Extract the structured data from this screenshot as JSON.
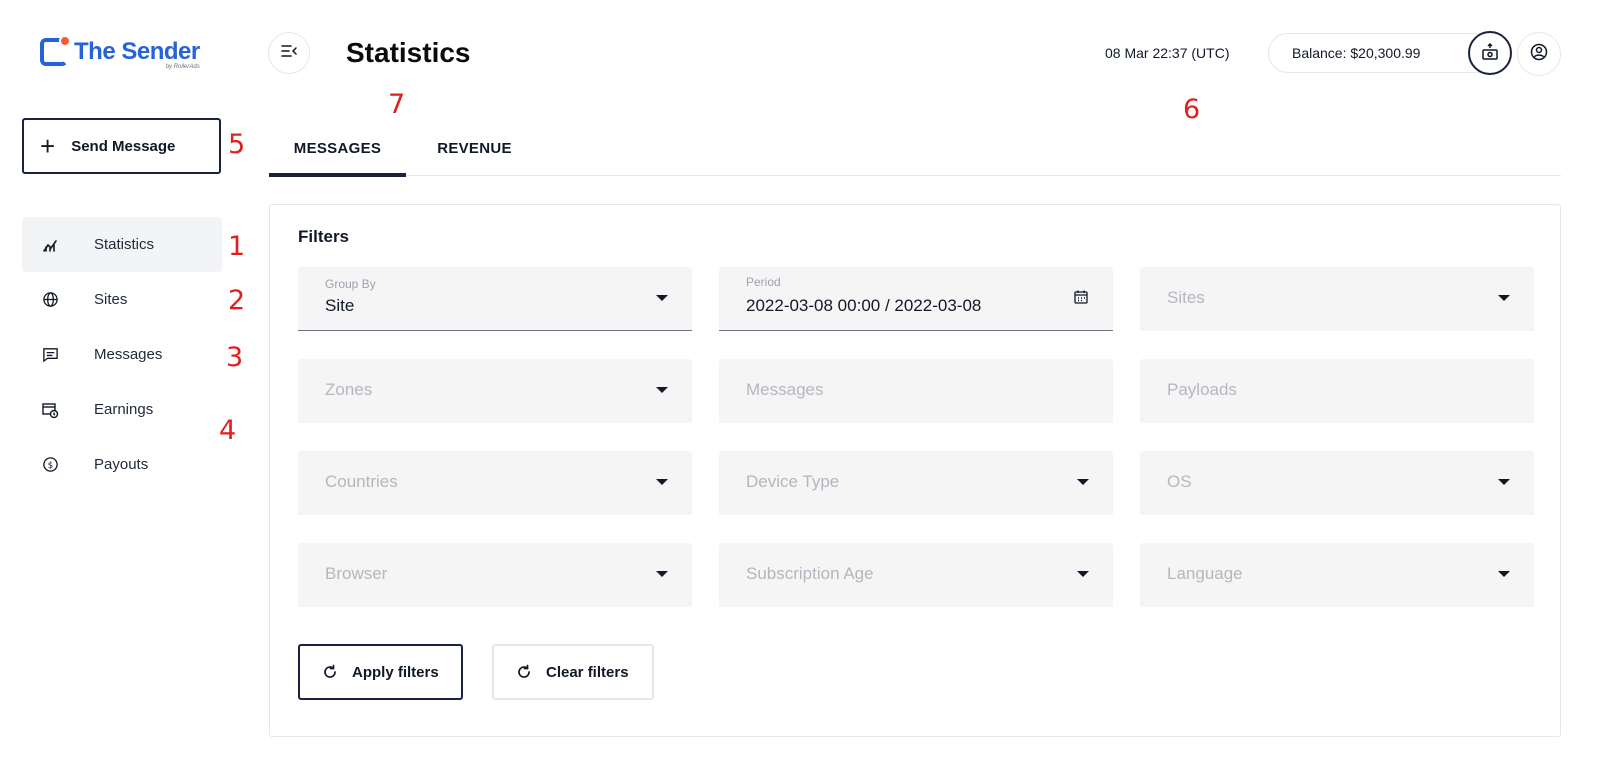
{
  "brand": {
    "name": "The Sender",
    "sub": "by RollerAds"
  },
  "send_button": {
    "label": "Send Message"
  },
  "sidebar": {
    "items": [
      {
        "label": "Statistics",
        "icon": "chart-icon",
        "active": true
      },
      {
        "label": "Sites",
        "icon": "globe-icon"
      },
      {
        "label": "Messages",
        "icon": "message-icon"
      },
      {
        "label": "Earnings",
        "icon": "earnings-icon"
      },
      {
        "label": "Payouts",
        "icon": "dollar-icon"
      }
    ]
  },
  "header": {
    "title": "Statistics",
    "clock": "08 Mar 22:37 (UTC)",
    "balance": "Balance: $20,300.99"
  },
  "tabs": [
    {
      "label": "MESSAGES",
      "active": true
    },
    {
      "label": "REVENUE",
      "active": false
    }
  ],
  "filters": {
    "title": "Filters",
    "group_by": {
      "label": "Group By",
      "value": "Site"
    },
    "period": {
      "label": "Period",
      "value": "2022-03-08 00:00 / 2022-03-08"
    },
    "sites": "Sites",
    "zones": "Zones",
    "messages": "Messages",
    "payloads": "Payloads",
    "countries": "Countries",
    "device_type": "Device Type",
    "os": "OS",
    "browser": "Browser",
    "subscription_age": "Subscription Age",
    "language": "Language"
  },
  "actions": {
    "apply": "Apply filters",
    "clear": "Clear filters"
  },
  "annotations": {
    "a1": "1",
    "a2": "2",
    "a3": "3",
    "a4": "4",
    "a5": "5",
    "a6": "6",
    "a7": "7"
  },
  "colors": {
    "brand": "#2563d8",
    "brand_dot": "#f45b3b",
    "dark": "#1a2240",
    "annotation": "#e0201c"
  }
}
